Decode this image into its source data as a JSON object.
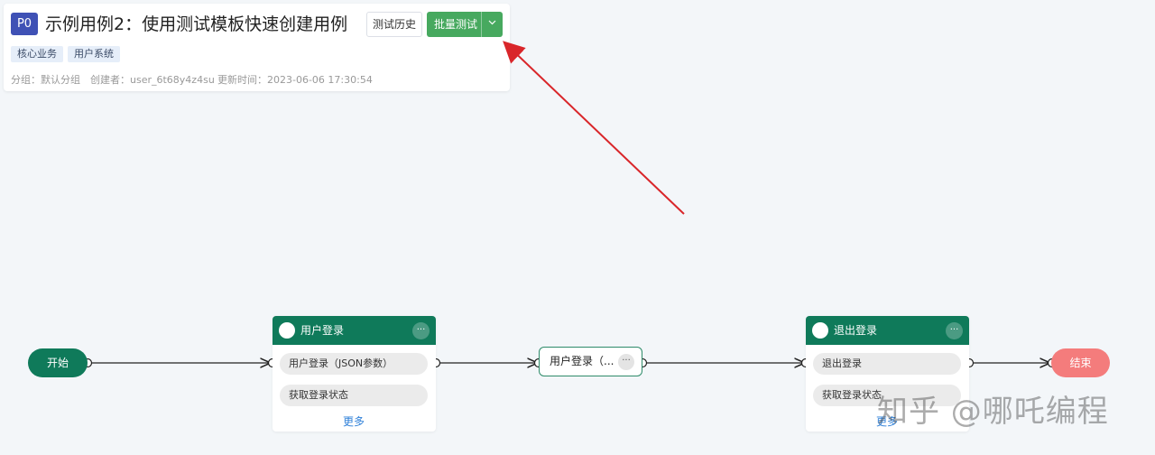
{
  "header": {
    "priority": "P0",
    "title": "示例用例2：使用测试模板快速创建用例",
    "history_button": "测试历史",
    "batch_button": "批量测试",
    "batch_dropdown_icon": "chevron-down-icon",
    "tags": [
      "核心业务",
      "用户系统"
    ],
    "meta": {
      "group": "分组：默认分组",
      "creator": "创建者：user_6t68y4z4su",
      "updated": "更新时间：2023-06-06 17:30:54"
    }
  },
  "flow": {
    "start": "开始",
    "end": "结束",
    "node_login": {
      "title": "用户登录",
      "more_icon": "···",
      "steps": [
        "用户登录（JSON参数）",
        "获取登录状态"
      ],
      "more_link": "更多"
    },
    "node_middle": {
      "title": "用户登录（...",
      "more_icon": "···"
    },
    "node_logout": {
      "title": "退出登录",
      "more_icon": "···",
      "steps": [
        "退出登录",
        "获取登录状态"
      ],
      "more_link": "更多"
    }
  },
  "watermark": "知乎 @哪吒编程",
  "colors": {
    "priority": "#3f51b5",
    "primary_green": "#47a95f",
    "node_green": "#0f7a5a",
    "end_red": "#f47c7c",
    "annotation_arrow": "#d9262a",
    "link_blue": "#2f80d8"
  }
}
